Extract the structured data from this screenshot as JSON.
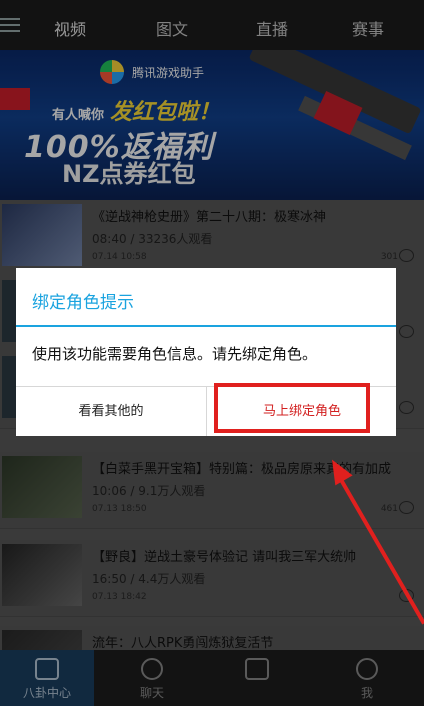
{
  "top_tabs": [
    "视频",
    "图文",
    "直播",
    "赛事"
  ],
  "banner": {
    "logo_text": "腾讯游戏助手",
    "line1_small": "有人喊你",
    "line1": "发红包啦！",
    "line2": "100%返福利",
    "line3": "NZ点券红包",
    "slides": 5,
    "active_slide": 1
  },
  "feed": [
    {
      "title": "《逆战神枪史册》第二十八期：极寒冰神",
      "meta": "08:40 / 33236人观看",
      "date": "07.14 10:58",
      "count": "301"
    },
    {
      "title": "",
      "meta": "",
      "date": "",
      "count": ""
    },
    {
      "title": "",
      "meta": "",
      "date": "",
      "count": ""
    },
    {
      "title": "【白菜手黑开宝箱】特别篇：极品房原来真的有加成",
      "meta": "10:06 / 9.1万人观看",
      "date": "07.13 18:50",
      "count": "461"
    },
    {
      "title": "【野良】逆战土豪号体验记 请叫我三军大统帅",
      "meta": "16:50 / 4.4万人观看",
      "date": "07.13 18:42",
      "count": ""
    },
    {
      "title": "流年：八人RPK勇闯炼狱复活节",
      "meta": "",
      "date": "",
      "count": ""
    }
  ],
  "dialog": {
    "title": "绑定角色提示",
    "message": "使用该功能需要角色信息。请先绑定角色。",
    "left_button": "看看其他的",
    "right_button": "马上绑定角色"
  },
  "bottom_nav": [
    "八卦中心",
    "聊天",
    "",
    "我"
  ],
  "colors": {
    "accent": "#1aa3df",
    "highlight": "#e0201e"
  }
}
